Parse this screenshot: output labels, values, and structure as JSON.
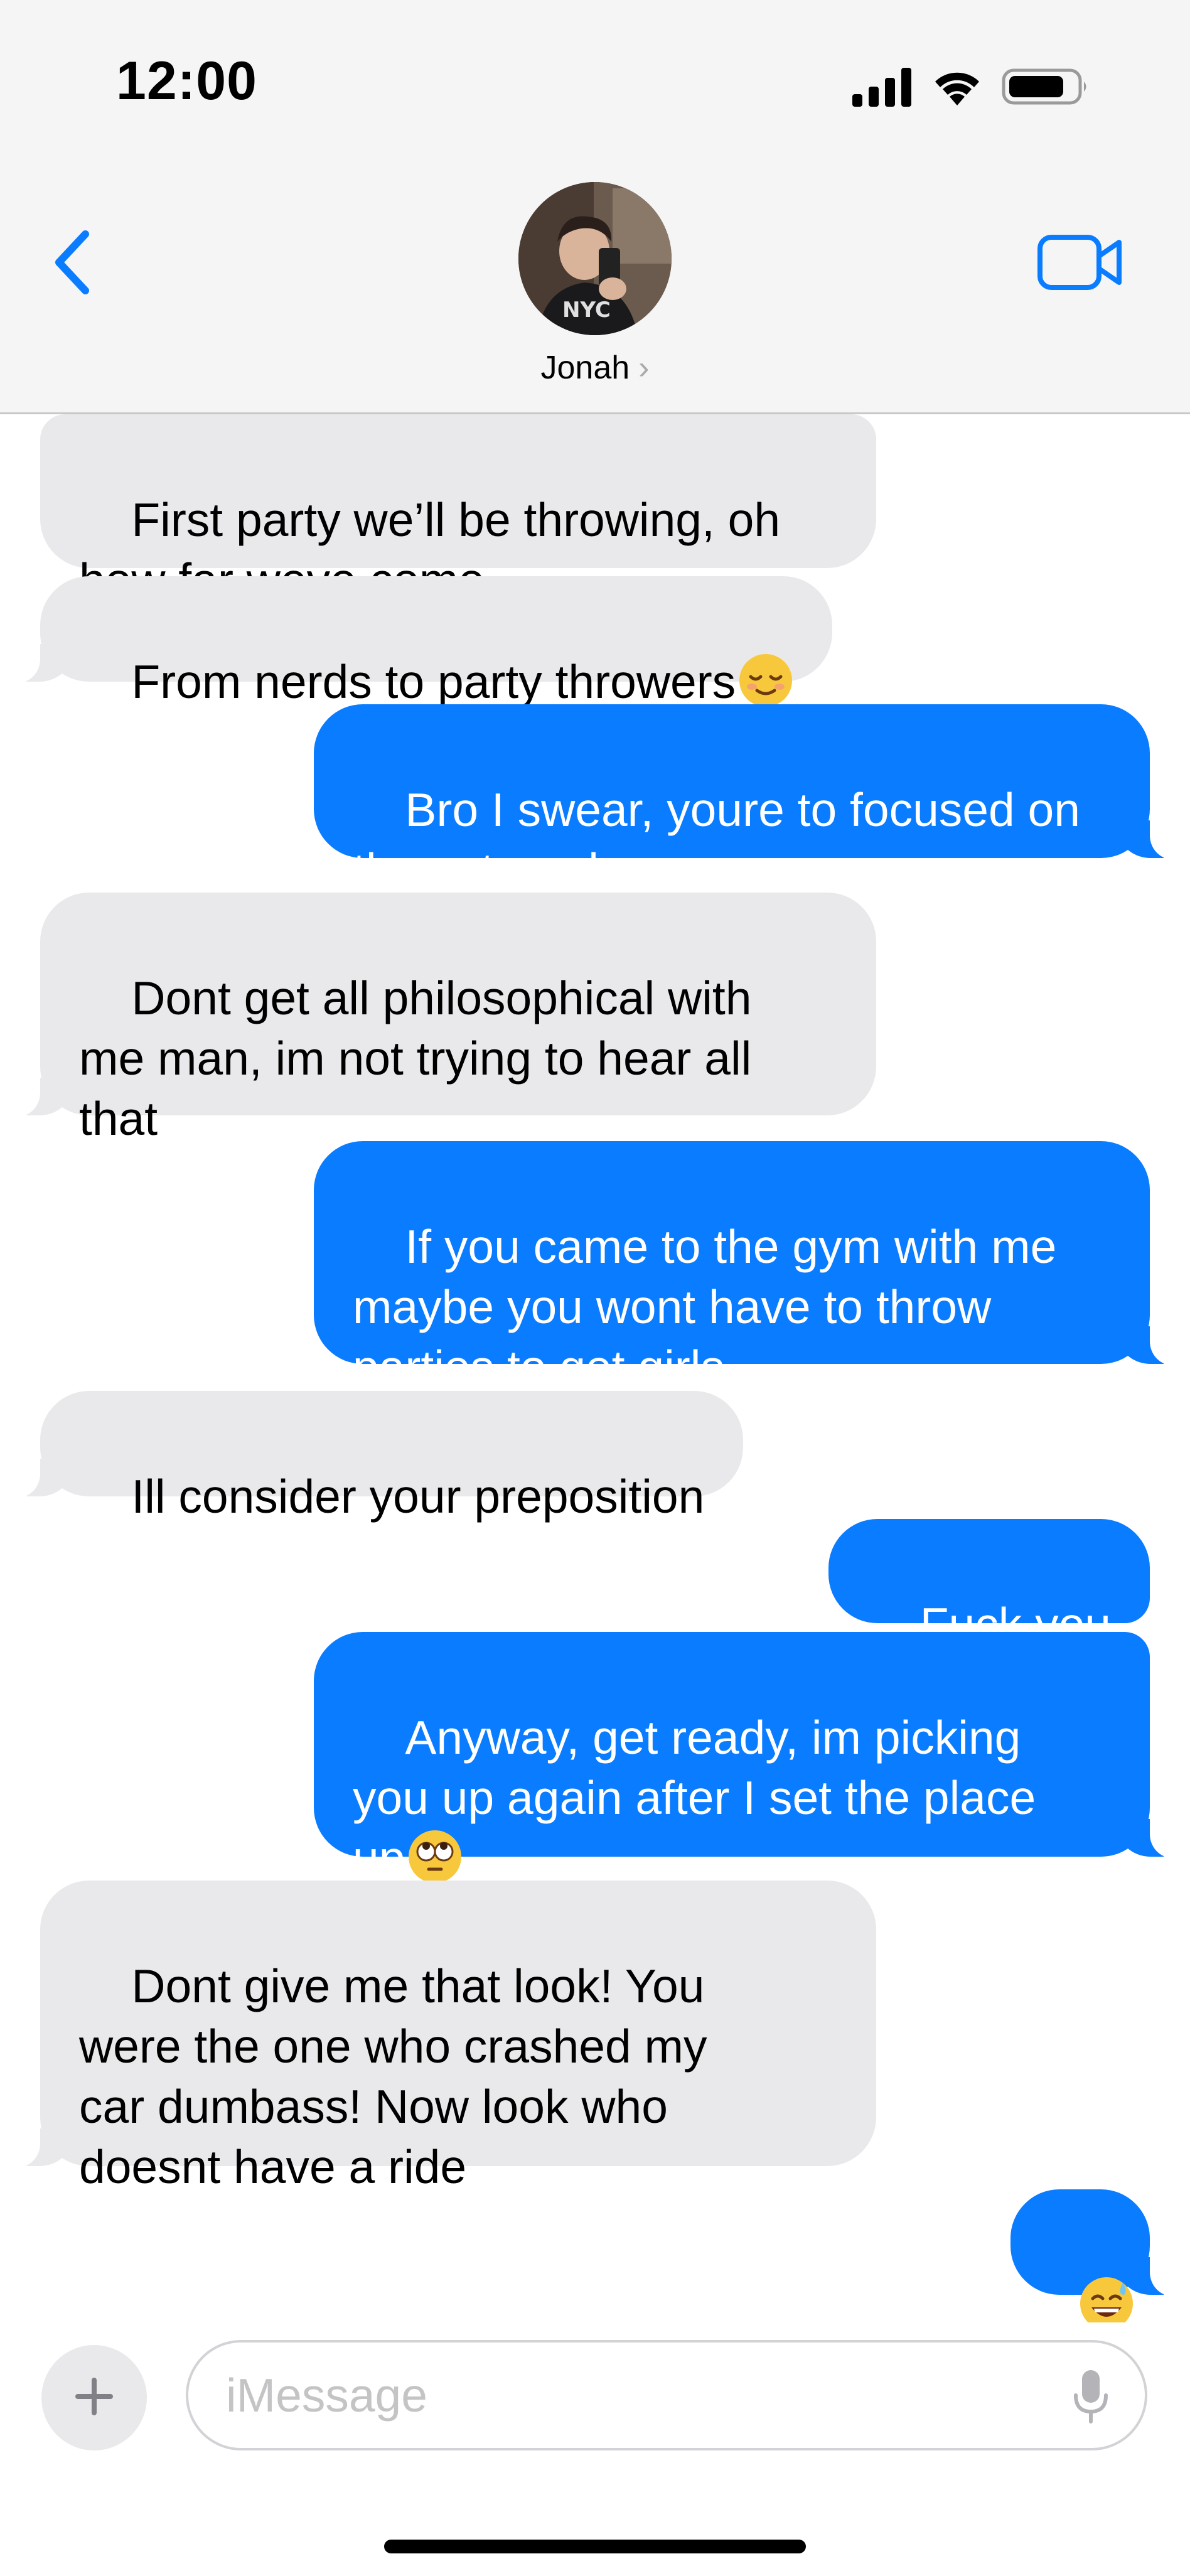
{
  "status_bar": {
    "time": "12:00"
  },
  "header": {
    "contact_name": "Jonah",
    "back_icon": "chevron-left-icon",
    "video_icon": "video-camera-icon",
    "accent_color": "#0a7cff"
  },
  "messages": [
    {
      "direction": "incoming",
      "text": "First party we’ll be throwing, oh\nhow far weve come"
    },
    {
      "direction": "incoming",
      "text": "From nerds to party throwers",
      "emoji": "relieved-face"
    },
    {
      "direction": "outgoing",
      "text": "Bro I swear, youre to focused on\nthe externals"
    },
    {
      "direction": "incoming",
      "text": "Dont get all philosophical with\nme man, im not trying to hear all\nthat"
    },
    {
      "direction": "outgoing",
      "text": "If you came to the gym with me\nmaybe you wont have to throw\nparties to get girls"
    },
    {
      "direction": "incoming",
      "text": "Ill consider your preposition"
    },
    {
      "direction": "outgoing",
      "text": "Fuck you"
    },
    {
      "direction": "outgoing",
      "text": "Anyway, get ready, im picking\nyou up again after I set the place\nup",
      "emoji": "eye-roll-face"
    },
    {
      "direction": "incoming",
      "text": "Dont give me that look! You\nwere the one who crashed my\ncar dumbass! Now look who\ndoesnt have a ride"
    },
    {
      "direction": "outgoing",
      "text": "",
      "emoji": "grinning-sweat-face"
    }
  ],
  "composer": {
    "placeholder": "iMessage",
    "plus_icon": "plus-icon",
    "mic_icon": "microphone-icon"
  },
  "colors": {
    "outgoing_bubble": "#0a7cff",
    "incoming_bubble": "#e9e9eb",
    "header_bg": "#f5f5f5"
  }
}
